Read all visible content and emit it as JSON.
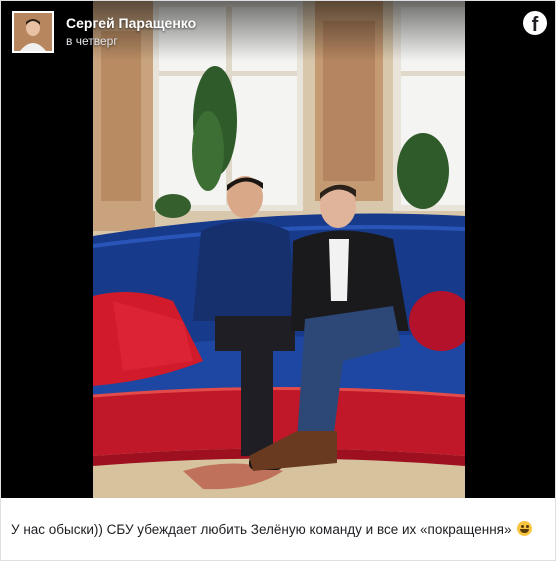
{
  "post": {
    "author_name": "Сергей Паращенко",
    "timestamp": "в четверг",
    "caption_text": "У нас обыски)) СБУ убеждает любить Зелёную команду и все их «покращення»",
    "caption_emoji": "smiling-face-emoji",
    "platform_icon": "facebook-logo-icon"
  },
  "colors": {
    "background": "#ffffff",
    "media_background": "#000000",
    "text": "#1c1e21",
    "sofa_blue": "#173a8a",
    "sofa_red": "#c01828"
  }
}
